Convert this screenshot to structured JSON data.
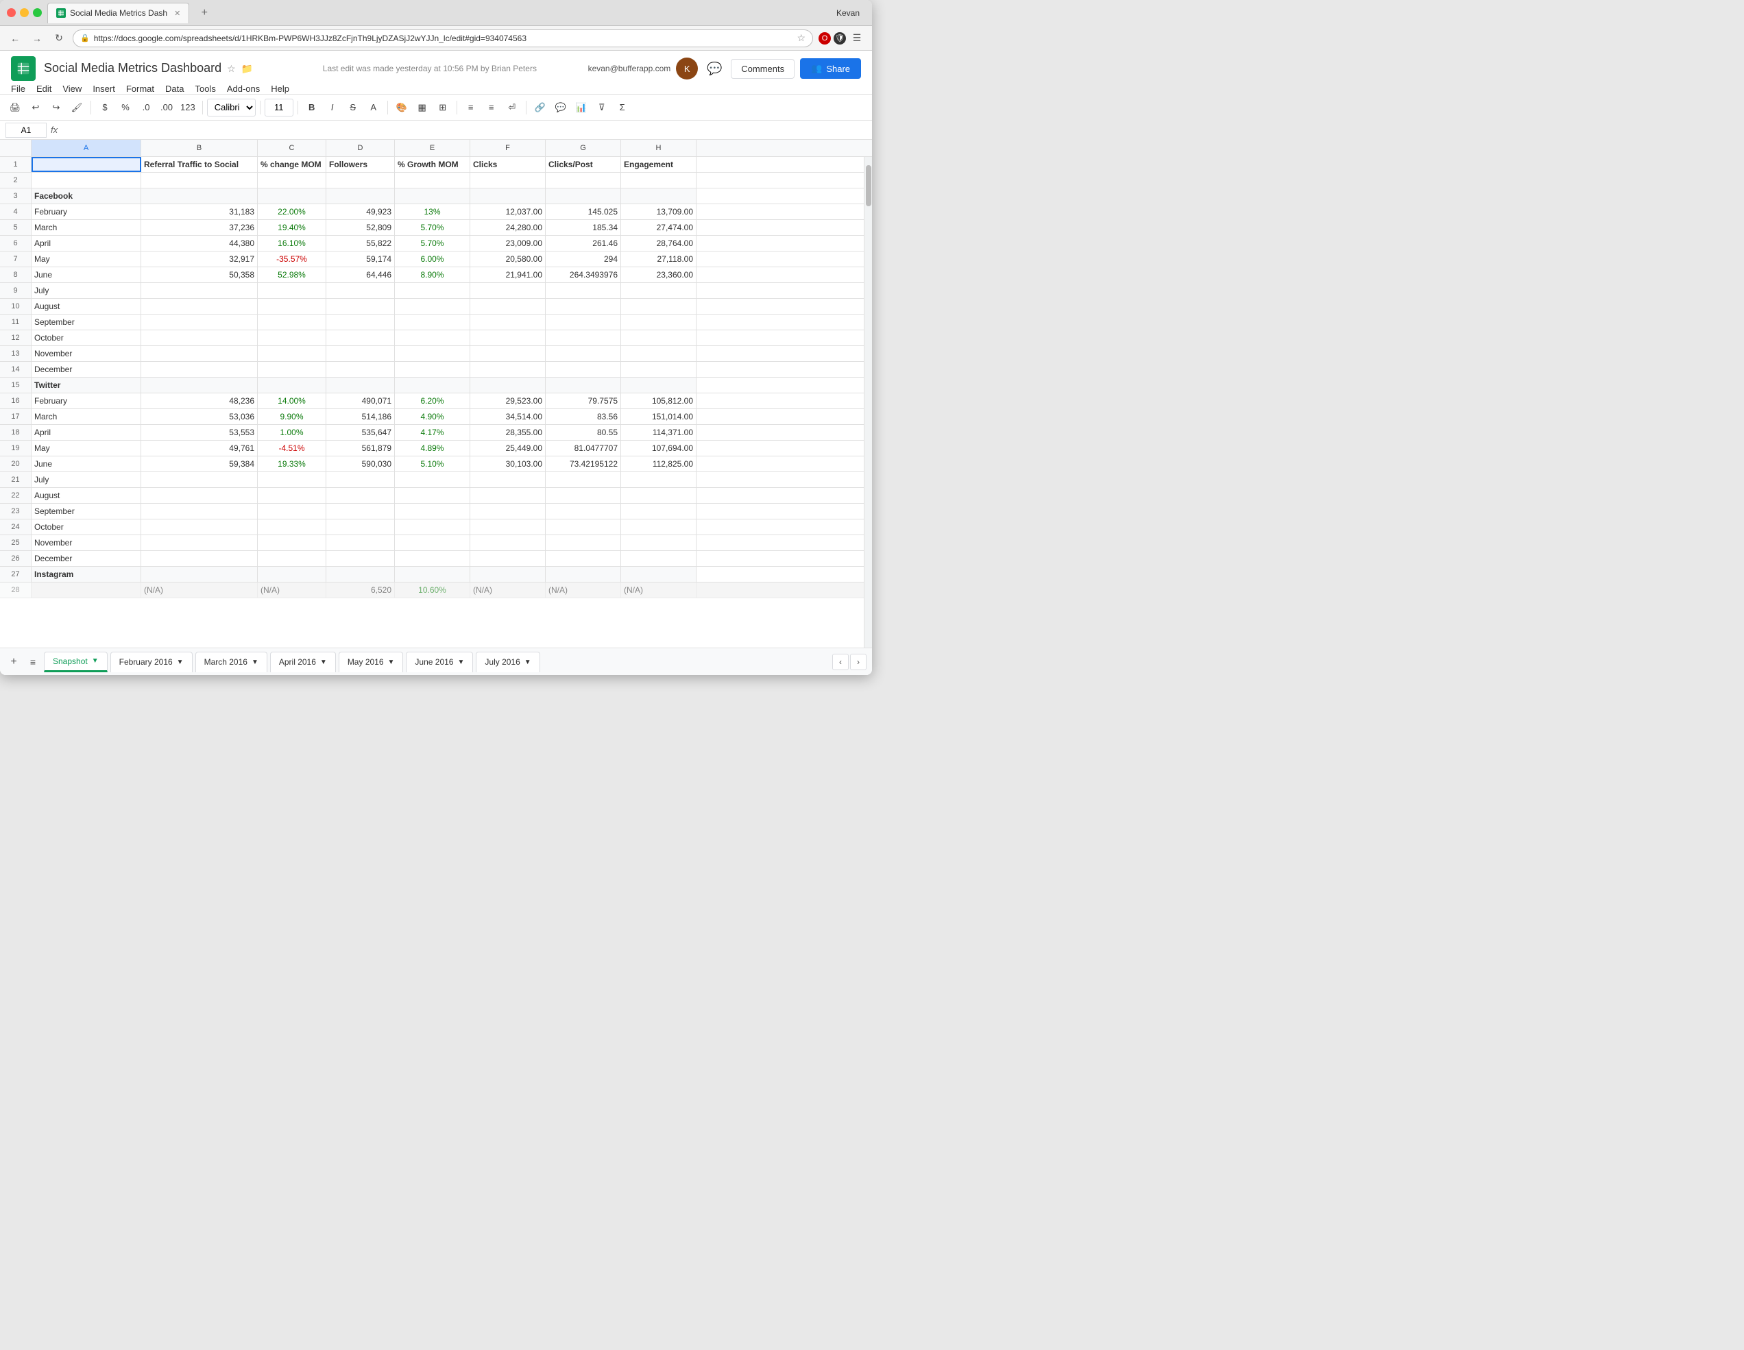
{
  "browser": {
    "url": "https://docs.google.com/spreadsheets/d/1HRKBm-PWP6WH3JJz8ZcFjnTh9LjyDZASjJ2wYJJn_lc/edit#gid=934074563",
    "tab_title": "Social Media Metrics Dash",
    "user": "Kevan"
  },
  "sheets": {
    "title": "Social Media Metrics Dashboard",
    "last_edit": "Last edit was made yesterday at 10:56 PM by Brian Peters",
    "user_email": "kevan@bufferapp.com",
    "menu": [
      "File",
      "Edit",
      "View",
      "Insert",
      "Format",
      "Data",
      "Tools",
      "Add-ons",
      "Help"
    ],
    "comments_label": "Comments",
    "share_label": "Share"
  },
  "toolbar": {
    "font": "Calibri",
    "size": "11",
    "dollar": "$",
    "percent": "%",
    "decimal_less": ".0",
    "decimal_more": ".00",
    "format_123": "123"
  },
  "columns": {
    "headers": [
      "A",
      "B",
      "C",
      "D",
      "E",
      "F",
      "G",
      "H"
    ],
    "row1": [
      "",
      "Referral Traffic to Social",
      "% change MOM",
      "Followers",
      "% Growth MOM",
      "Clicks",
      "Clicks/Post",
      "Engagement"
    ]
  },
  "rows": {
    "facebook_header": "Facebook",
    "facebook_data": [
      {
        "month": "February",
        "b": "31,183",
        "c": "22.00%",
        "c_color": "green",
        "d": "49,923",
        "e": "13%",
        "e_color": "green",
        "f": "12,037.00",
        "g": "145.025",
        "h": "13,709.00"
      },
      {
        "month": "March",
        "b": "37,236",
        "c": "19.40%",
        "c_color": "green",
        "d": "52,809",
        "e": "5.70%",
        "e_color": "green",
        "f": "24,280.00",
        "g": "185.34",
        "h": "27,474.00"
      },
      {
        "month": "April",
        "b": "44,380",
        "c": "16.10%",
        "c_color": "green",
        "d": "55,822",
        "e": "5.70%",
        "e_color": "green",
        "f": "23,009.00",
        "g": "261.46",
        "h": "28,764.00"
      },
      {
        "month": "May",
        "b": "32,917",
        "c": "-35.57%",
        "c_color": "red",
        "d": "59,174",
        "e": "6.00%",
        "e_color": "green",
        "f": "20,580.00",
        "g": "294",
        "h": "27,118.00"
      },
      {
        "month": "June",
        "b": "50,358",
        "c": "52.98%",
        "c_color": "green",
        "d": "64,446",
        "e": "8.90%",
        "e_color": "green",
        "f": "21,941.00",
        "g": "264.3493976",
        "h": "23,360.00"
      },
      {
        "month": "July",
        "b": "",
        "c": "",
        "c_color": "",
        "d": "",
        "e": "",
        "e_color": "",
        "f": "",
        "g": "",
        "h": ""
      },
      {
        "month": "August",
        "b": "",
        "c": "",
        "c_color": "",
        "d": "",
        "e": "",
        "e_color": "",
        "f": "",
        "g": "",
        "h": ""
      },
      {
        "month": "September",
        "b": "",
        "c": "",
        "c_color": "",
        "d": "",
        "e": "",
        "e_color": "",
        "f": "",
        "g": "",
        "h": ""
      },
      {
        "month": "October",
        "b": "",
        "c": "",
        "c_color": "",
        "d": "",
        "e": "",
        "e_color": "",
        "f": "",
        "g": "",
        "h": ""
      },
      {
        "month": "November",
        "b": "",
        "c": "",
        "c_color": "",
        "d": "",
        "e": "",
        "e_color": "",
        "f": "",
        "g": "",
        "h": ""
      },
      {
        "month": "December",
        "b": "",
        "c": "",
        "c_color": "",
        "d": "",
        "e": "",
        "e_color": "",
        "f": "",
        "g": "",
        "h": ""
      }
    ],
    "twitter_header": "Twitter",
    "twitter_data": [
      {
        "month": "February",
        "b": "48,236",
        "c": "14.00%",
        "c_color": "green",
        "d": "490,071",
        "e": "6.20%",
        "e_color": "green",
        "f": "29,523.00",
        "g": "79.7575",
        "h": "105,812.00"
      },
      {
        "month": "March",
        "b": "53,036",
        "c": "9.90%",
        "c_color": "green",
        "d": "514,186",
        "e": "4.90%",
        "e_color": "green",
        "f": "34,514.00",
        "g": "83.56",
        "h": "151,014.00"
      },
      {
        "month": "April",
        "b": "53,553",
        "c": "1.00%",
        "c_color": "green",
        "d": "535,647",
        "e": "4.17%",
        "e_color": "green",
        "f": "28,355.00",
        "g": "80.55",
        "h": "114,371.00"
      },
      {
        "month": "May",
        "b": "49,761",
        "c": "-4.51%",
        "c_color": "red",
        "d": "561,879",
        "e": "4.89%",
        "e_color": "green",
        "f": "25,449.00",
        "g": "81.0477707",
        "h": "107,694.00"
      },
      {
        "month": "June",
        "b": "59,384",
        "c": "19.33%",
        "c_color": "green",
        "d": "590,030",
        "e": "5.10%",
        "e_color": "green",
        "f": "30,103.00",
        "g": "73.42195122",
        "h": "112,825.00"
      },
      {
        "month": "July",
        "b": "",
        "c": "",
        "c_color": "",
        "d": "",
        "e": "",
        "e_color": "",
        "f": "",
        "g": "",
        "h": ""
      },
      {
        "month": "August",
        "b": "",
        "c": "",
        "c_color": "",
        "d": "",
        "e": "",
        "e_color": "",
        "f": "",
        "g": "",
        "h": ""
      },
      {
        "month": "September",
        "b": "",
        "c": "",
        "c_color": "",
        "d": "",
        "e": "",
        "e_color": "",
        "f": "",
        "g": "",
        "h": ""
      },
      {
        "month": "October",
        "b": "",
        "c": "",
        "c_color": "",
        "d": "",
        "e": "",
        "e_color": "",
        "f": "",
        "g": "",
        "h": ""
      },
      {
        "month": "November",
        "b": "",
        "c": "",
        "c_color": "",
        "d": "",
        "e": "",
        "e_color": "",
        "f": "",
        "g": "",
        "h": ""
      },
      {
        "month": "December",
        "b": "",
        "c": "",
        "c_color": "",
        "d": "",
        "e": "",
        "e_color": "",
        "f": "",
        "g": "",
        "h": ""
      }
    ],
    "instagram_header": "Instagram"
  },
  "sheet_tabs": [
    {
      "label": "Snapshot",
      "type": "snapshot"
    },
    {
      "label": "February 2016",
      "type": "normal"
    },
    {
      "label": "March 2016",
      "type": "normal"
    },
    {
      "label": "April 2016",
      "type": "normal"
    },
    {
      "label": "May 2016",
      "type": "normal"
    },
    {
      "label": "June 2016",
      "type": "normal"
    },
    {
      "label": "July 2016",
      "type": "normal"
    }
  ]
}
